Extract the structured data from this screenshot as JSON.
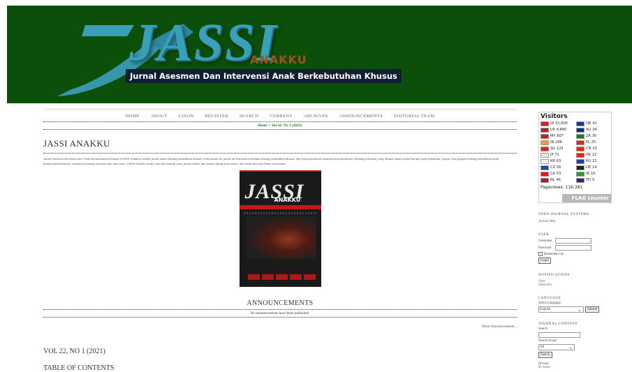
{
  "header": {
    "logo_word": "JASSI",
    "logo_sub": "ANAKKU",
    "logo_tagline": "Jurnal Asesmen Dan Intervensi Anak Berkebutuhan Khusus",
    "bg_color": "#0b4f0b"
  },
  "nav": {
    "items": [
      "HOME",
      "ABOUT",
      "LOGIN",
      "REGISTER",
      "SEARCH",
      "CURRENT",
      "ARCHIVES",
      "ANNOUNCEMENTS",
      "EDITORIAL TEAM"
    ]
  },
  "breadcrumb": "Home > Vol 22, No 1 (2021)",
  "journal_title": "JASSI ANAKKU",
  "description": "Jurnal Asesmen dan Intervensi Anak Berkebutuhan Khusus (JASSI Anakku) adalah jurnal dalam bidang pendidikan khusus, oleh karena itu jurnal ini berisikan keilmuan bidang pendidikan khusus, dari hasil penelitian maupun hasil pemikiran. Bidang keilmuan yang dimuat dalam jurnal berupa hasil penelitian, kajian, dan gagasan bidang pendidikan anak berkebutuhan khusus, utamanya tentang asesmen dan intervensi. JASSI Anakku terdiri dari dua bentuk yaitu jurnal offline dan jurnal daring atau online, dan terbit dua kali dalam satu tahun.",
  "cover": {
    "title": "JASSI",
    "subtitle": "ANAKKU"
  },
  "announcements": {
    "title": "ANNOUNCEMENTS",
    "empty_text": "No announcements have been published.",
    "more_link": "More Announcements..."
  },
  "issue": {
    "title": "VOL 22, NO 1 (2021)",
    "toc_title": "TABLE OF CONTENTS"
  },
  "sidebar": {
    "flag_counter": {
      "title": "Visitors",
      "rows": [
        {
          "code": "ID",
          "count": "51,600",
          "color": "#d62020"
        },
        {
          "code": "GB",
          "count": "41",
          "color": "#22339a"
        },
        {
          "code": "US",
          "count": "4,840",
          "color": "#b22234"
        },
        {
          "code": "AU",
          "count": "34",
          "color": "#1a2a80"
        },
        {
          "code": "MY",
          "count": "607",
          "color": "#cc1a1a"
        },
        {
          "code": "ZA",
          "count": "30",
          "color": "#1e7a3a"
        },
        {
          "code": "IN",
          "count": "246",
          "color": "#ff9933"
        },
        {
          "code": "PL",
          "count": "25",
          "color": "#e0242e"
        },
        {
          "code": "SG",
          "count": "125",
          "color": "#e02020"
        },
        {
          "code": "CN",
          "count": "23",
          "color": "#de2910"
        },
        {
          "code": "JP",
          "count": "71",
          "color": "#e8e8e8"
        },
        {
          "code": "HK",
          "count": "22",
          "color": "#de2910"
        },
        {
          "code": "KR",
          "count": "63",
          "color": "#f0f0f0"
        },
        {
          "code": "RU",
          "count": "21",
          "color": "#2040a0"
        },
        {
          "code": "CZ",
          "count": "56",
          "color": "#1a4fa0"
        },
        {
          "code": "DE",
          "count": "14",
          "color": "#222222"
        },
        {
          "code": "CA",
          "count": "53",
          "color": "#e01a1a"
        },
        {
          "code": "IR",
          "count": "10",
          "color": "#2a9a3a"
        },
        {
          "code": "NL",
          "count": "46",
          "color": "#ae1c28"
        },
        {
          "code": "TH",
          "count": "9",
          "color": "#2d2a6e"
        }
      ],
      "pageviews_label": "Pageviews:",
      "pageviews": "116,381",
      "brand": "FLAG counter"
    },
    "ojs_label": "OPEN JOURNAL SYSTEMS",
    "journal_help": "Journal Help",
    "user_head": "USER",
    "username_label": "Username",
    "password_label": "Password",
    "remember_label": "Remember me",
    "login_button": "Login",
    "notifications_head": "NOTIFICATIONS",
    "view_link": "View",
    "subscribe_link": "Subscribe",
    "language_head": "LANGUAGE",
    "select_language_label": "Select Language",
    "language_value": "English",
    "submit_button": "Submit",
    "journal_content_head": "JOURNAL CONTENT",
    "search_label": "Search",
    "search_scope_label": "Search Scope",
    "scope_value": "All",
    "search_button": "Search",
    "browse_label": "Browse",
    "by_issue_label": "By Issue"
  }
}
